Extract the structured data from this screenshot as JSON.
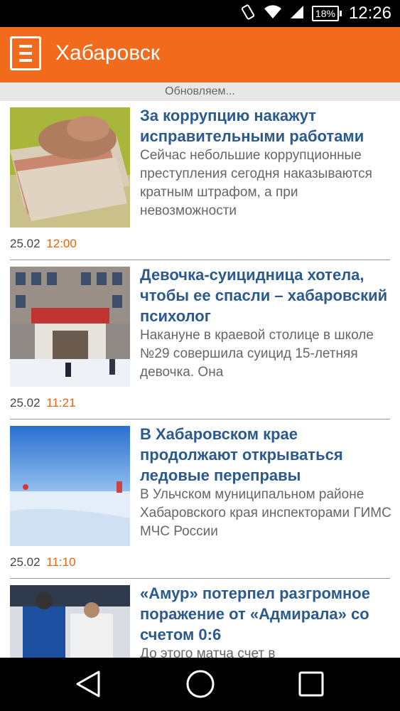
{
  "status_bar": {
    "battery": "18%",
    "time": "12:26"
  },
  "app_bar": {
    "title": "Хабаровск"
  },
  "updating_text": "Обновляем...",
  "news": [
    {
      "headline": "За коррупцию накажут исправительными работами",
      "snippet": "Сейчас небольшие коррупционные преступления сегодня наказываются кратным штрафом, а при невозможности",
      "date": "25.02",
      "time": "12:00"
    },
    {
      "headline": "Девочка-суицидница хотела, чтобы ее спасли – хабаровский психолог",
      "snippet": "Накануне в краевой столице в школе №29 совершила суицид 15-летняя девочка. Она",
      "date": "25.02",
      "time": "11:21"
    },
    {
      "headline": "В Хабаровском крае продолжают открываться ледовые переправы",
      "snippet": "В Ульчском муниципальном районе Хабаровского края инспекторами ГИМС МЧС России",
      "date": "25.02",
      "time": "11:10"
    },
    {
      "headline": "«Амур» потерпел разгромное поражение от «Адмирала» со счетом 0:6",
      "snippet": "До этого матча счет в",
      "date": "",
      "time": ""
    }
  ]
}
